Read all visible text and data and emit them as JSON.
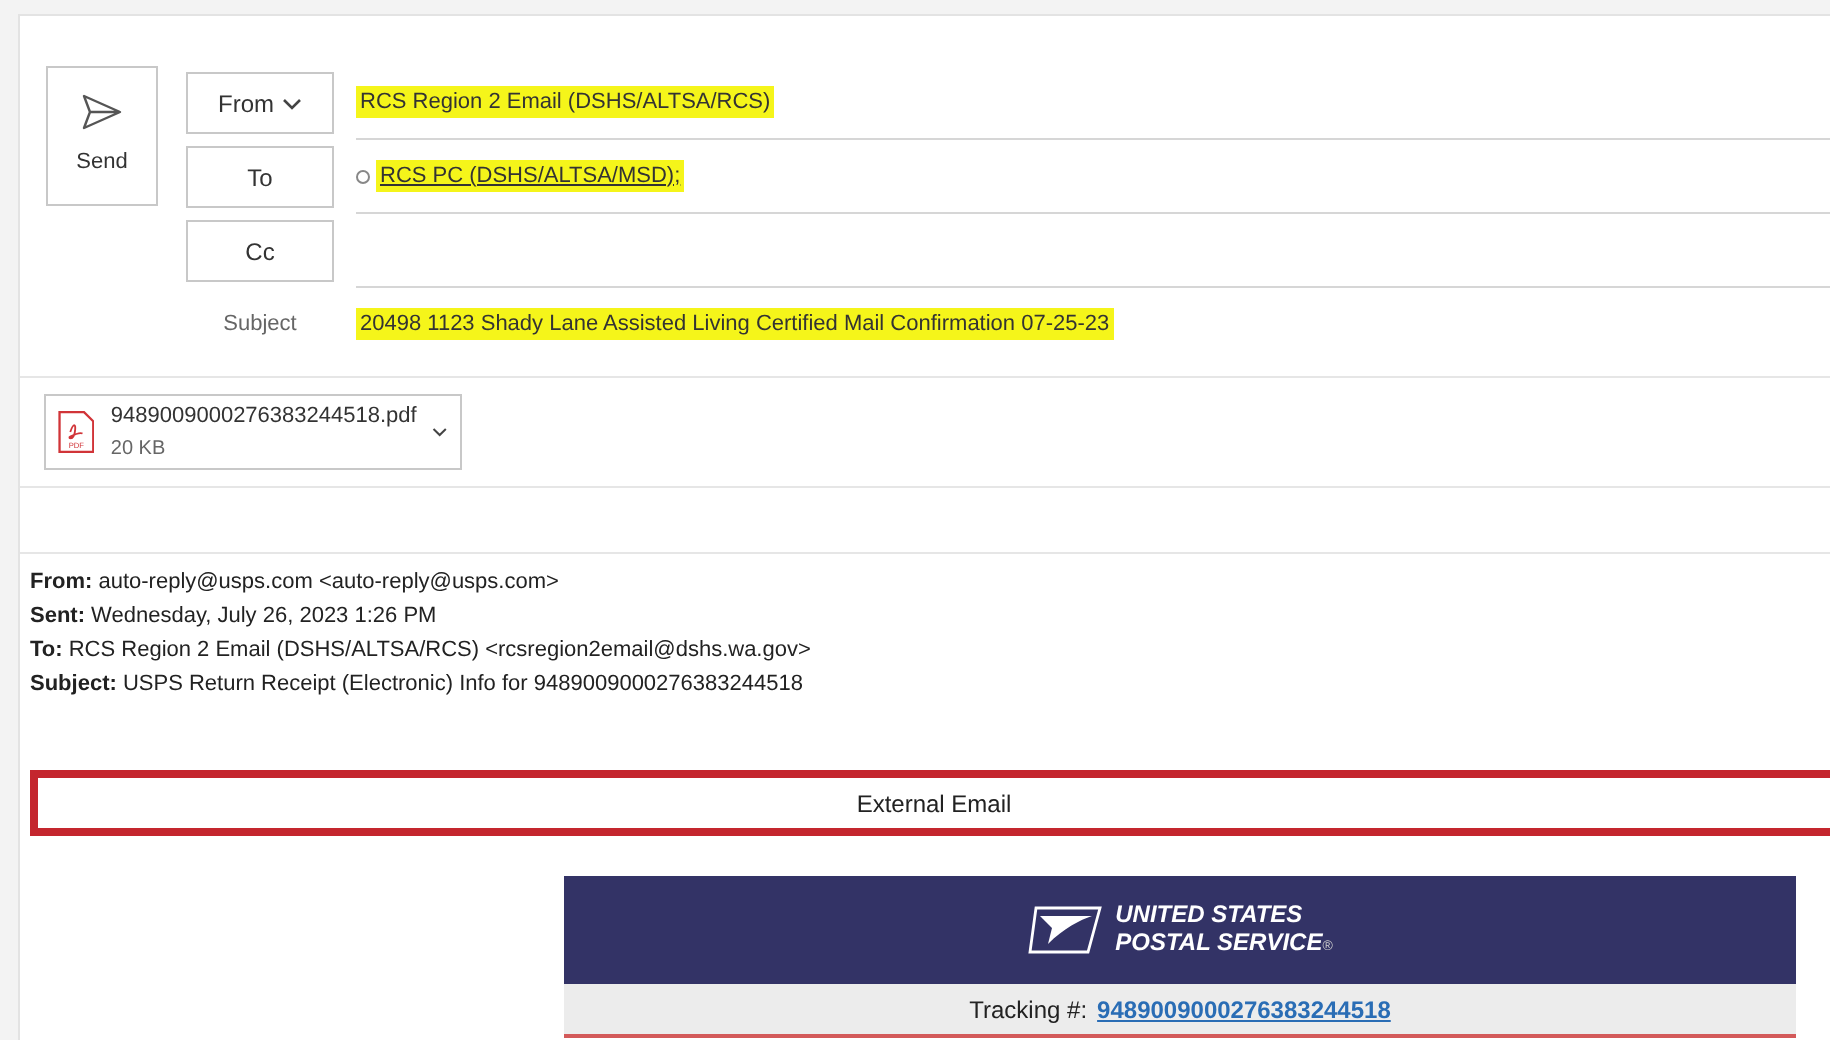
{
  "compose": {
    "send_label": "Send",
    "fields": [
      {
        "kind": "from",
        "button": "From",
        "value": "RCS Region 2 Email  (DSHS/ALTSA/RCS)",
        "highlighted": true
      },
      {
        "kind": "to",
        "button": "To",
        "value": "RCS PC  (DSHS/ALTSA/MSD);",
        "highlighted": true
      },
      {
        "kind": "cc",
        "button": "Cc"
      }
    ],
    "subject": {
      "label": "Subject",
      "value": "20498 1123 Shady Lane Assisted Living Certified Mail Confirmation 07-25-23",
      "highlighted": true
    },
    "attachment": {
      "icon_text": "PDF",
      "name": "9489009000276383244518.pdf",
      "size": "20 KB"
    }
  },
  "forwarded_header": [
    "**From:** auto-reply@usps.com <auto-reply@usps.com>",
    "**Sent:** Wednesday, July 26, 2023 1:26 PM",
    "**To:** RCS Region 2 Email (DSHS/ALTSA/RCS) <rcsregion2email@dshs.wa.gov>",
    "**Subject:** USPS Return Receipt (Electronic) Info for 9489009000276383244518"
  ],
  "external_banner": "External Email",
  "usps": {
    "logo_lines": [
      "UNITED STATES",
      "POSTAL SERVICE"
    ],
    "logo_mark": "®",
    "tracking_label": "Tracking #:",
    "tracking_number": "9489009000276383244518"
  }
}
